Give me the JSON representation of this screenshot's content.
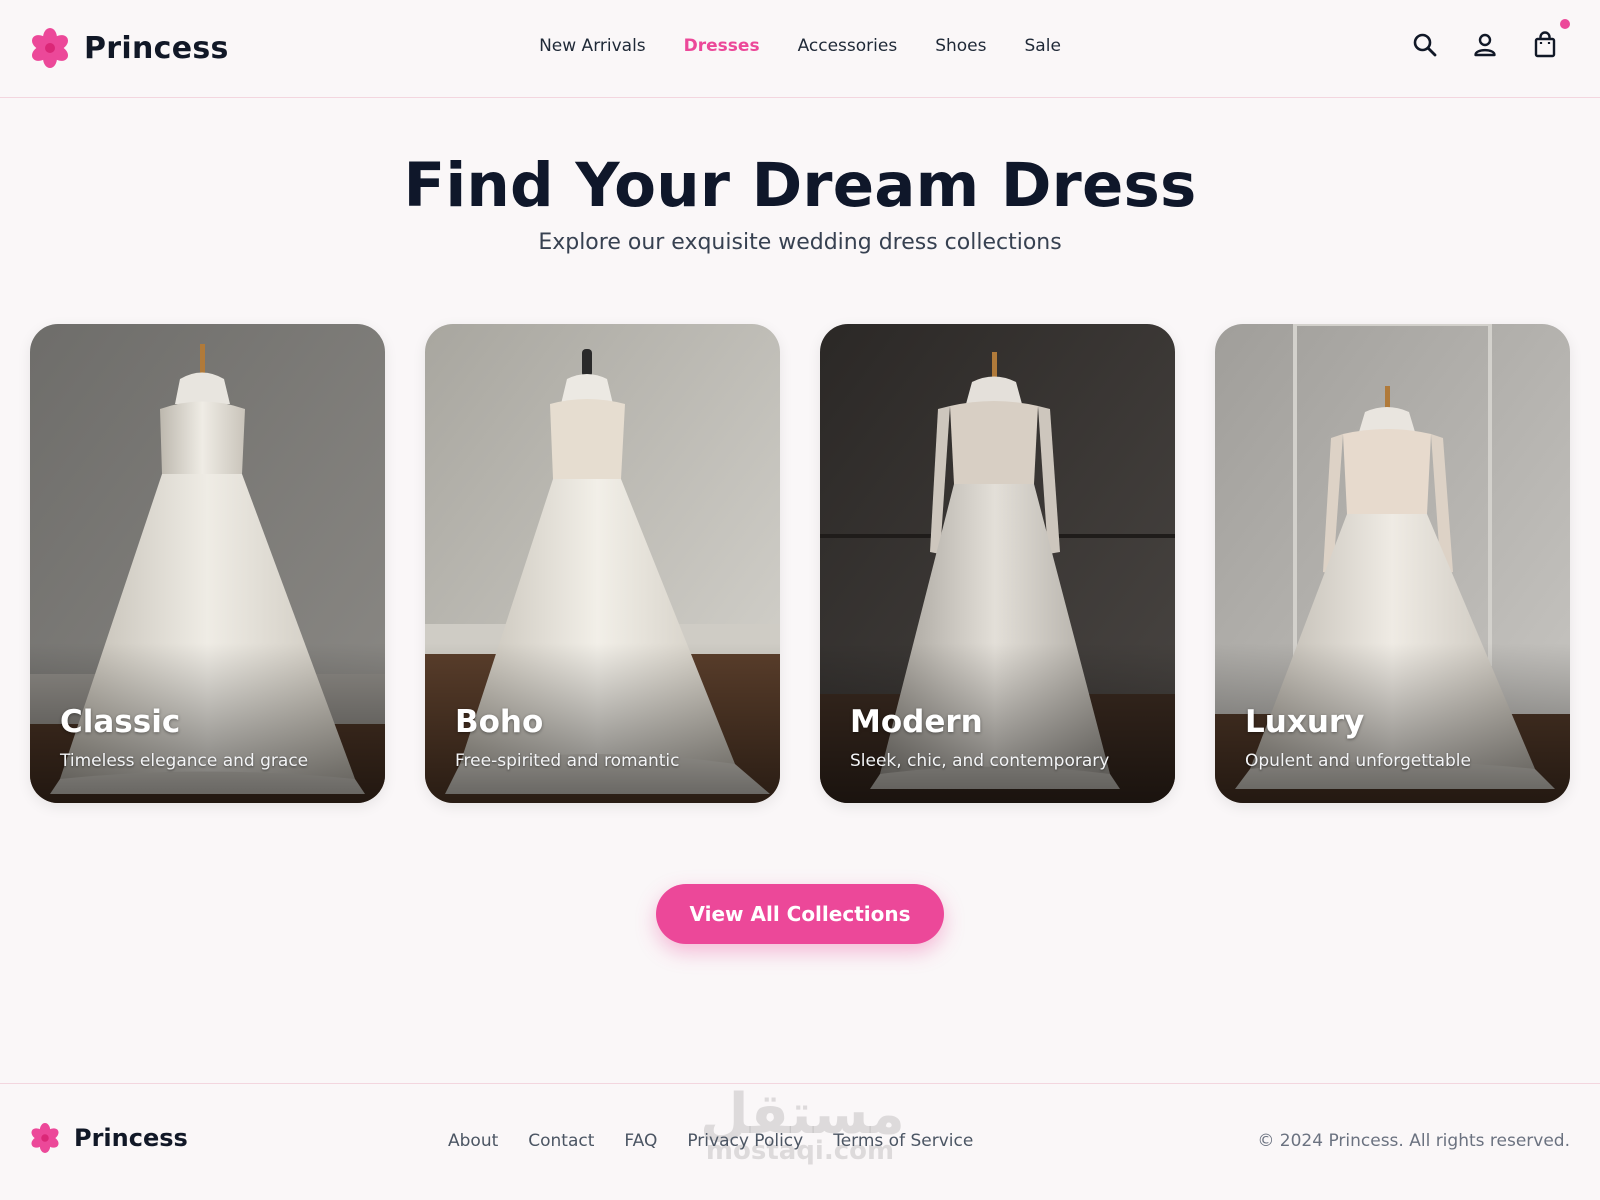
{
  "header": {
    "brand": "Princess",
    "nav": [
      {
        "label": "New Arrivals",
        "active": false
      },
      {
        "label": "Dresses",
        "active": true
      },
      {
        "label": "Accessories",
        "active": false
      },
      {
        "label": "Shoes",
        "active": false
      },
      {
        "label": "Sale",
        "active": false
      }
    ],
    "icons": [
      "search-icon",
      "user-icon",
      "shopping-bag-icon"
    ],
    "cart_has_items": true
  },
  "hero": {
    "title": "Find Your Dream Dress",
    "subtitle": "Explore our exquisite wedding dress collections"
  },
  "collections": [
    {
      "title": "Classic",
      "description": "Timeless elegance and grace"
    },
    {
      "title": "Boho",
      "description": "Free-spirited and romantic"
    },
    {
      "title": "Modern",
      "description": "Sleek, chic, and contemporary"
    },
    {
      "title": "Luxury",
      "description": "Opulent and unforgettable"
    }
  ],
  "cta": {
    "label": "View All Collections"
  },
  "footer": {
    "brand": "Princess",
    "links": [
      "About",
      "Contact",
      "FAQ",
      "Privacy Policy",
      "Terms of Service"
    ],
    "copyright": "© 2024 Princess. All rights reserved."
  },
  "watermark": {
    "line1": "مستقل",
    "line2": "mostaqi.com"
  },
  "colors": {
    "accent": "#ec4899",
    "text": "#0f172a",
    "background": "#faf7f8"
  }
}
